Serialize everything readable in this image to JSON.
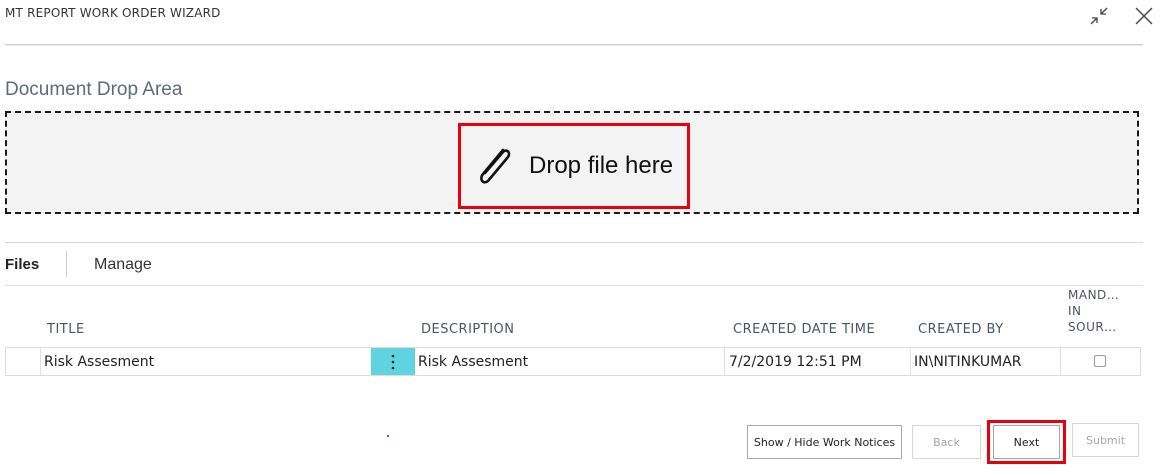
{
  "window": {
    "title": "MT REPORT WORK ORDER WIZARD",
    "controls": {
      "collapse_icon": "collapse-arrows-icon",
      "close_icon": "close-x-icon"
    }
  },
  "drop_section": {
    "title": "Document Drop Area",
    "icon": "paperclip-icon",
    "text": "Drop file here"
  },
  "tabs": [
    "Files",
    "Manage"
  ],
  "table": {
    "columns": {
      "title": "TITLE",
      "description": "DESCRIPTION",
      "created_date_time": "CREATED DATE TIME",
      "created_by": "CREATED BY",
      "mandatory": [
        "MAND…",
        "IN",
        "SOUR…"
      ]
    },
    "rows": [
      {
        "title": "Risk Assesment",
        "description": "Risk Assesment",
        "created_date_time": "7/2/2019 12:51 PM",
        "created_by": "IN\\NITINKUMAR",
        "mandatory_checked": false
      }
    ]
  },
  "footer": {
    "show_hide": "Show / Hide Work Notices",
    "back": "Back",
    "next": "Next",
    "submit": "Submit"
  },
  "colors": {
    "highlight": "#e8000f",
    "row_menu": "#5fd3e0"
  }
}
